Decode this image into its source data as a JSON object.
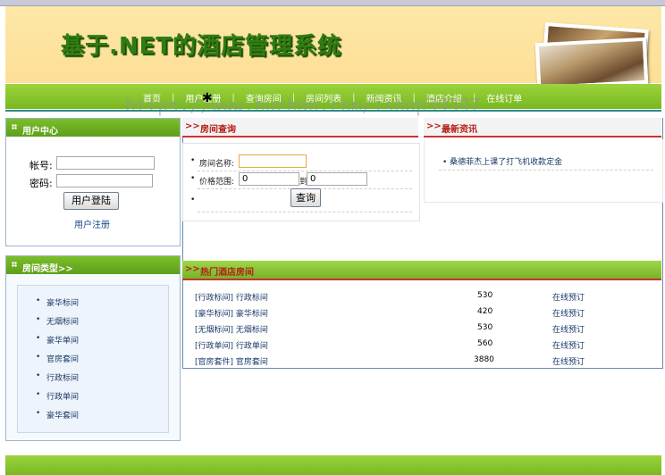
{
  "header": {
    "title": "基于.NET的酒店管理系统"
  },
  "nav": {
    "items": [
      "首页",
      "用户注册",
      "查询房间",
      "房间列表",
      "新闻资讯",
      "酒店介绍",
      "在线订单"
    ]
  },
  "watermark": "https://www.huzhan.com/ishop39397",
  "user_center": {
    "title": "用户中心",
    "account_label": "帐号:",
    "password_label": "密码:",
    "login_button": "用户登陆",
    "register_link": "用户注册"
  },
  "room_types": {
    "title": "房间类型>>",
    "items": [
      "豪华标间",
      "无烟标间",
      "豪华单间",
      "官房套间",
      "行政标间",
      "行政单间",
      "豪华套间"
    ]
  },
  "room_query": {
    "title": "房间查询",
    "name_label": "房间名称:",
    "price_label": "价格范围:",
    "price_from": "0",
    "to_label": "到",
    "price_to": "0",
    "search_button": "查询"
  },
  "news": {
    "title": "最新资讯",
    "items": [
      "桑德菲杰上课了打飞机收款定金"
    ]
  },
  "hot_rooms": {
    "title": "热门酒店房间",
    "rows": [
      {
        "type": "[行政标间] 行政标间",
        "price": "530",
        "action": "在线预订"
      },
      {
        "type": "[豪华标间] 豪华标间",
        "price": "420",
        "action": "在线预订"
      },
      {
        "type": "[无烟标间] 无烟标间",
        "price": "530",
        "action": "在线预订"
      },
      {
        "type": "[行政单间] 行政单间",
        "price": "560",
        "action": "在线预订"
      },
      {
        "type": "[官房套件] 官房套间",
        "price": "3880",
        "action": "在线预订"
      }
    ]
  },
  "colors": {
    "nav_green": "#79b822",
    "title_green": "#2f7d10",
    "section_red": "#b52018",
    "banner_yellow": "#fde7a8"
  }
}
